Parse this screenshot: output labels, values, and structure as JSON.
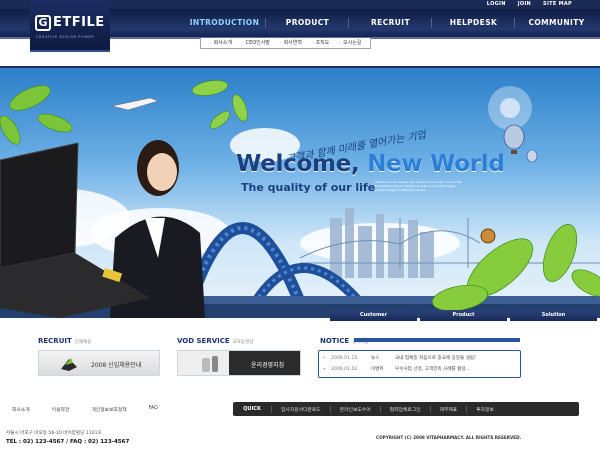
{
  "util_links": [
    "LOGIN",
    "JOIN",
    "SITE MAP"
  ],
  "logo": {
    "text": "ETFILE",
    "mark": "G",
    "tagline": "CREATIVE  DESIGN  POWER"
  },
  "nav": [
    "INTRODUCTION",
    "PRODUCT",
    "RECRUIT",
    "HELPDESK",
    "COMMUNITY"
  ],
  "subnav": [
    "회사소개",
    "CEO인사말",
    "회사연혁",
    "조직도",
    "오시는길"
  ],
  "hero": {
    "script": "고객과 함께 미래를 열어가는 기업",
    "welcome_a": "Welcome,",
    "welcome_b": "New World",
    "quality": "The quality of our life",
    "fine": "Creative visual design has always consciously chosen the boundaries beyond design, as well as a model design project design for Beyond the end"
  },
  "banner_tabs": [
    "Customer",
    "Product",
    "Solution"
  ],
  "recruit": {
    "title": "RECRUIT",
    "sub": "인재채용",
    "box": "2008 신입채용안내"
  },
  "vod": {
    "title": "VOD SERVICE",
    "sub": "교육동영상",
    "box": "윤리경영지침"
  },
  "notice": {
    "title": "NOTICE",
    "sub": "공지사항",
    "rows": [
      {
        "date": "2006.01.15",
        "cat": "뉴스",
        "text": "국내 업체중 처음으로 중국에 공장을 설립!"
      },
      {
        "date": "2006.01.02",
        "cat": "이벤트",
        "text": "우수사업 선정, 고객만족 사례를 활용..."
      }
    ]
  },
  "footer_links": [
    "회사소개",
    "이용약관",
    "개인정보보호정책",
    "FAQ"
  ],
  "quick": {
    "label": "QUICK",
    "links": [
      "입사지원서다운로드",
      "온라인보도수어",
      "협력업체로그인",
      "재무제표",
      "투자정보"
    ]
  },
  "address": "서울시 마포구 마포동 56-10 바이팜빌딩 1101호",
  "tel": "TEL : 02) 123-4567  /  FAQ : 02) 123-4567",
  "copyright": "COPYRIGHT (C) 2008 VITAPHARMACY. ALL RIGHTS RESERVED."
}
